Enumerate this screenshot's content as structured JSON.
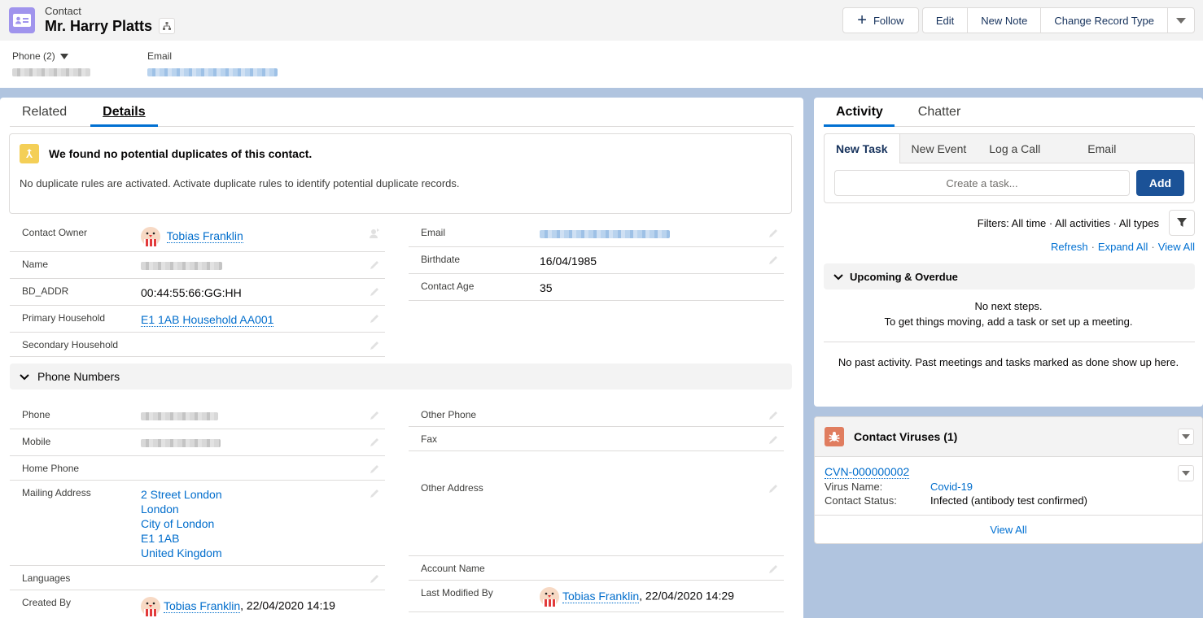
{
  "header": {
    "object_type": "Contact",
    "record_name": "Mr. Harry Platts",
    "actions": {
      "follow": "Follow",
      "edit": "Edit",
      "new_note": "New Note",
      "change_record_type": "Change Record Type"
    },
    "highlights": {
      "phone_label": "Phone (2)",
      "email_label": "Email"
    }
  },
  "left": {
    "tabs": [
      {
        "label": "Related",
        "active": false
      },
      {
        "label": "Details",
        "active": true
      }
    ],
    "duplicates": {
      "title": "We found no potential duplicates of this contact.",
      "message": "No duplicate rules are activated. Activate duplicate rules to identify potential duplicate records."
    },
    "fields_left": [
      {
        "label": "Contact Owner",
        "value": "Tobias Franklin"
      },
      {
        "label": "Name",
        "value": ""
      },
      {
        "label": "BD_ADDR",
        "value": "00:44:55:66:GG:HH"
      },
      {
        "label": "Primary Household",
        "value": "E1 1AB Household AA001"
      },
      {
        "label": "Secondary Household",
        "value": ""
      }
    ],
    "fields_right": [
      {
        "label": "Email",
        "value": ""
      },
      {
        "label": "Birthdate",
        "value": "16/04/1985"
      },
      {
        "label": "Contact Age",
        "value": "35"
      }
    ],
    "phone_section": {
      "title": "Phone Numbers",
      "left": [
        {
          "label": "Phone",
          "value": ""
        },
        {
          "label": "Mobile",
          "value": ""
        },
        {
          "label": "Home Phone",
          "value": ""
        },
        {
          "label": "Mailing Address",
          "lines": [
            "2 Street London",
            "London",
            "City of London",
            "E1 1AB",
            "United Kingdom"
          ]
        },
        {
          "label": "Languages",
          "value": ""
        },
        {
          "label": "Created By",
          "user": "Tobias Franklin",
          "timestamp": ", 22/04/2020 14:19"
        }
      ],
      "right": [
        {
          "label": "Other Phone",
          "value": ""
        },
        {
          "label": "Fax",
          "value": ""
        },
        {
          "label": "Other Address",
          "value": ""
        },
        {
          "label": "Account Name",
          "value": ""
        },
        {
          "label": "Last Modified By",
          "user": "Tobias Franklin",
          "timestamp": ", 22/04/2020 14:29"
        }
      ]
    }
  },
  "activity": {
    "tabs": [
      {
        "label": "Activity",
        "active": true
      },
      {
        "label": "Chatter",
        "active": false
      }
    ],
    "composer_tabs": [
      "New Task",
      "New Event",
      "Log a Call",
      "Email"
    ],
    "task_placeholder": "Create a task...",
    "add_label": "Add",
    "filters": "Filters: All time · All activities · All types",
    "links": {
      "refresh": "Refresh",
      "expand_all": "Expand All",
      "view_all": "View All"
    },
    "upcoming_title": "Upcoming & Overdue",
    "no_next_steps": "No next steps.",
    "get_moving": "To get things moving, add a task or set up a meeting.",
    "no_past": "No past activity. Past meetings and tasks marked as done show up here."
  },
  "viruses": {
    "title": "Contact Viruses (1)",
    "record": {
      "id": "CVN-000000002",
      "virus_name_label": "Virus Name:",
      "virus_name": "Covid-19",
      "status_label": "Contact Status:",
      "status": "Infected (antibody test confirmed)"
    },
    "view_all": "View All"
  }
}
